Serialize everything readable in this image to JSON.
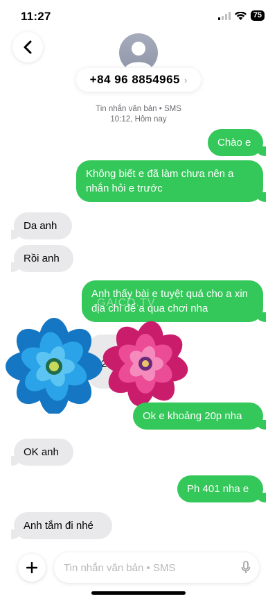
{
  "status_bar": {
    "time": "11:27",
    "battery": "75"
  },
  "header": {
    "contact": "+84 96 8854965",
    "chevron": "›"
  },
  "meta": {
    "line1": "Tin nhắn văn bản • SMS",
    "line2": "10:12, Hôm nay"
  },
  "messages": [
    {
      "side": "out",
      "text": "Chào e"
    },
    {
      "side": "out",
      "text": "Không biết e đã làm chưa nên a nhắn hỏi e trước"
    },
    {
      "side": "in",
      "text": "Da anh"
    },
    {
      "side": "in",
      "text": "Rồi anh"
    },
    {
      "side": "out",
      "text": "Anh thấy bài e tuyệt quá cho a xin địa chỉ để a qua chơi nha"
    },
    {
      "side": "in",
      "text": "2"
    },
    {
      "side": "out",
      "text": "Ok e khoảng 20p nha"
    },
    {
      "side": "in",
      "text": "OK anh"
    },
    {
      "side": "out",
      "text": "Ph 401 nha e"
    },
    {
      "side": "in",
      "text": "Anh tắm đi nhé"
    }
  ],
  "watermark": "GAICO.TV",
  "composer": {
    "placeholder": "Tin nhắn văn bản • SMS"
  },
  "colors": {
    "outgoing": "#34c759",
    "incoming": "#e9e9eb",
    "flower_blue": "#1e8fd6",
    "flower_pink": "#e23b8a"
  },
  "icons": [
    "back-icon",
    "avatar-person-icon",
    "plus-icon",
    "mic-icon",
    "signal-icon",
    "wifi-icon",
    "battery-icon"
  ]
}
